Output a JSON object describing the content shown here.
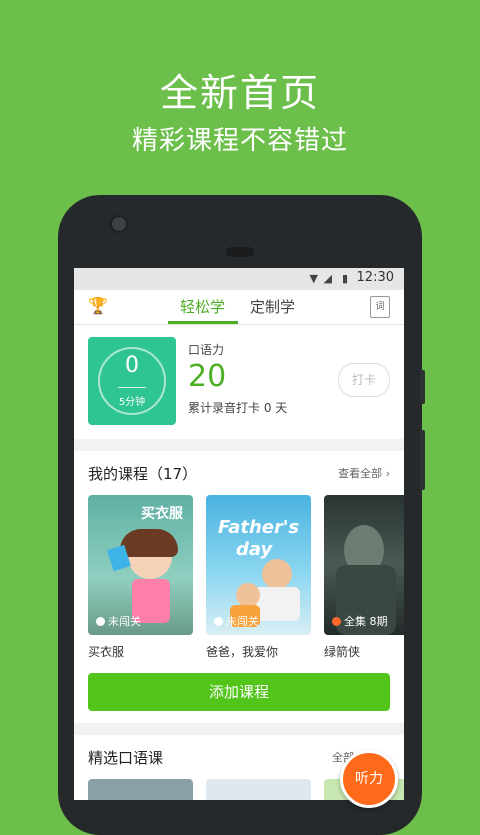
{
  "promo": {
    "headline": "全新首页",
    "subheadline": "精彩课程不容错过"
  },
  "status_bar": {
    "time": "12:30"
  },
  "nav": {
    "tab_easy": "轻松学",
    "tab_custom": "定制学",
    "dict_label": "词"
  },
  "practice": {
    "timer_value": "0",
    "timer_unit": "5分钟",
    "oral_label": "口语力",
    "oral_value": "20",
    "streak_text": "累计录音打卡 0 天",
    "checkin_label": "打卡"
  },
  "my_courses": {
    "title": "我的课程（17）",
    "see_all": "查看全部",
    "items": [
      {
        "name": "买衣服",
        "badge": "买衣服",
        "status": "未闯关"
      },
      {
        "name": "爸爸，我爱你",
        "badge": "",
        "status": "未闯关"
      },
      {
        "name": "绿箭侠",
        "badge": "",
        "status": "全集 8期"
      }
    ],
    "add_button": "添加课程"
  },
  "featured": {
    "title": "精选口语课",
    "see_all": "全部"
  },
  "fab_label": "听力",
  "colors": {
    "background": "#6cbf4a",
    "accent": "#4caf24",
    "button_green": "#52c41a",
    "timer_teal": "#2ec494",
    "fab_orange": "#ff6a1a"
  }
}
